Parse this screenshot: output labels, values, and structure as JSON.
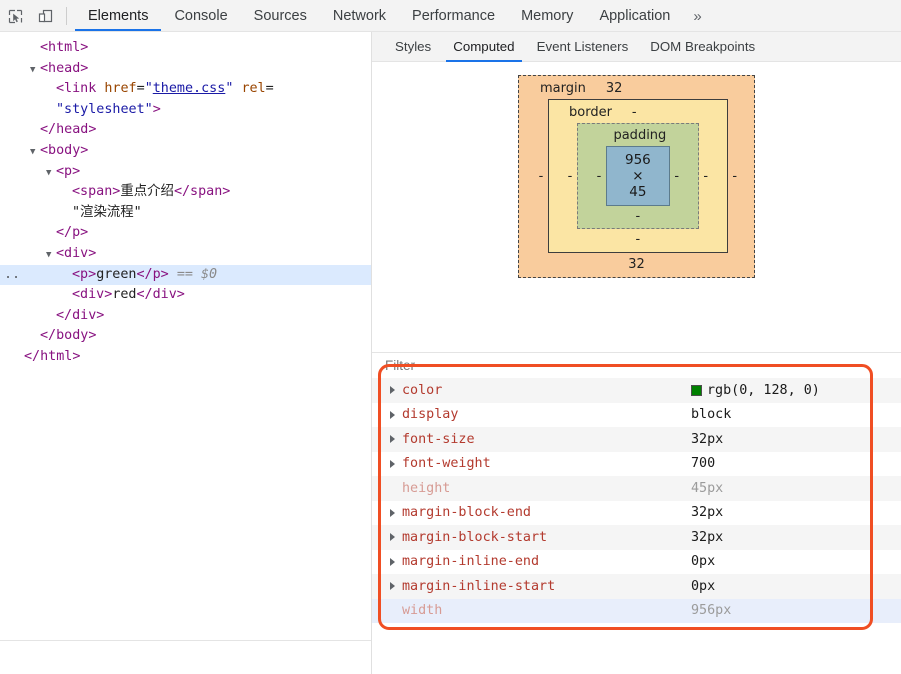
{
  "toolbar": {
    "inspect_icon": "inspect-cursor-icon",
    "device_icon": "device-toolbar-icon",
    "tabs": [
      {
        "label": "Elements",
        "active": true
      },
      {
        "label": "Console",
        "active": false
      },
      {
        "label": "Sources",
        "active": false
      },
      {
        "label": "Network",
        "active": false
      },
      {
        "label": "Performance",
        "active": false
      },
      {
        "label": "Memory",
        "active": false
      },
      {
        "label": "Application",
        "active": false
      }
    ],
    "overflow_label": "»"
  },
  "dom_tree": {
    "lines": [
      {
        "indent": 0,
        "triangle": "",
        "html": "<span class=\"tag\">&lt;html&gt;</span>"
      },
      {
        "indent": 0,
        "triangle": "▼",
        "html": "<span class=\"tag\">&lt;head&gt;</span>"
      },
      {
        "indent": 1,
        "triangle": "",
        "html": "<span class=\"tag\">&lt;link</span> <span class=\"attrname\">href</span>=<span class=\"attrval\">\"<u>theme.css</u>\"</span> <span class=\"attrname\">rel</span>="
      },
      {
        "indent": 1,
        "triangle": "",
        "html": "<span class=\"attrval\">\"stylesheet\"</span><span class=\"tag\">&gt;</span>"
      },
      {
        "indent": 0,
        "triangle": "",
        "html": "<span class=\"tag\">&lt;/head&gt;</span>"
      },
      {
        "indent": 0,
        "triangle": "▼",
        "html": "<span class=\"tag\">&lt;body&gt;</span>"
      },
      {
        "indent": 1,
        "triangle": "▼",
        "html": "<span class=\"tag\">&lt;p&gt;</span>"
      },
      {
        "indent": 2,
        "triangle": "",
        "html": "<span class=\"tag\">&lt;span&gt;</span><span class=\"txt\">重点介绍</span><span class=\"tag\">&lt;/span&gt;</span>"
      },
      {
        "indent": 2,
        "triangle": "",
        "html": "<span class=\"txt\">\"渲染流程\"</span>"
      },
      {
        "indent": 1,
        "triangle": "",
        "html": "<span class=\"tag\">&lt;/p&gt;</span>"
      },
      {
        "indent": 1,
        "triangle": "▼",
        "html": "<span class=\"tag\">&lt;div&gt;</span>"
      },
      {
        "indent": 2,
        "triangle": "",
        "selected": true,
        "dots": "..",
        "html": "<span class=\"tag\">&lt;p&gt;</span><span class=\"txt\">green</span><span class=\"tag\">&lt;/p&gt;</span> <span class=\"eq\">==</span> <span class=\"dollar\">$0</span>"
      },
      {
        "indent": 2,
        "triangle": "",
        "html": "<span class=\"tag\">&lt;div&gt;</span><span class=\"txt\">red</span><span class=\"tag\">&lt;/div&gt;</span>"
      },
      {
        "indent": 1,
        "triangle": "",
        "html": "<span class=\"tag\">&lt;/div&gt;</span>"
      },
      {
        "indent": 0,
        "triangle": "",
        "html": "<span class=\"tag\">&lt;/body&gt;</span>"
      },
      {
        "indent": -1,
        "triangle": "",
        "html": "<span class=\"tag\">&lt;/html&gt;</span>"
      }
    ]
  },
  "sidebar": {
    "tabs": [
      {
        "label": "Styles",
        "active": false
      },
      {
        "label": "Computed",
        "active": true
      },
      {
        "label": "Event Listeners",
        "active": false
      },
      {
        "label": "DOM Breakpoints",
        "active": false
      }
    ]
  },
  "box_model": {
    "margin_label": "margin",
    "margin_top": "32",
    "margin_right": "-",
    "margin_bottom": "32",
    "margin_left": "-",
    "border_label": "border",
    "border_top": "-",
    "border_right": "-",
    "border_bottom": "-",
    "border_left": "-",
    "padding_label": "padding",
    "padding_top": "",
    "padding_right": "-",
    "padding_bottom": "-",
    "padding_left": "-",
    "content_size": "956 × 45",
    "colors": {
      "margin": "#f9cc9d",
      "border": "#fbe5a4",
      "padding": "#c2d39b",
      "content": "#90b6cd"
    }
  },
  "filter": {
    "placeholder": "Filter"
  },
  "computed_properties": [
    {
      "name": "color",
      "value": "rgb(0, 128, 0)",
      "swatch": "#008000",
      "expandable": true,
      "dimmed": false,
      "rowstyle": "odd"
    },
    {
      "name": "display",
      "value": "block",
      "swatch": null,
      "expandable": true,
      "dimmed": false,
      "rowstyle": "plain"
    },
    {
      "name": "font-size",
      "value": "32px",
      "swatch": null,
      "expandable": true,
      "dimmed": false,
      "rowstyle": "odd"
    },
    {
      "name": "font-weight",
      "value": "700",
      "swatch": null,
      "expandable": true,
      "dimmed": false,
      "rowstyle": "plain"
    },
    {
      "name": "height",
      "value": "45px",
      "swatch": null,
      "expandable": false,
      "dimmed": true,
      "rowstyle": "odd"
    },
    {
      "name": "margin-block-end",
      "value": "32px",
      "swatch": null,
      "expandable": true,
      "dimmed": false,
      "rowstyle": "plain"
    },
    {
      "name": "margin-block-start",
      "value": "32px",
      "swatch": null,
      "expandable": true,
      "dimmed": false,
      "rowstyle": "odd"
    },
    {
      "name": "margin-inline-end",
      "value": "0px",
      "swatch": null,
      "expandable": true,
      "dimmed": false,
      "rowstyle": "plain"
    },
    {
      "name": "margin-inline-start",
      "value": "0px",
      "swatch": null,
      "expandable": true,
      "dimmed": false,
      "rowstyle": "odd"
    },
    {
      "name": "width",
      "value": "956px",
      "swatch": null,
      "expandable": false,
      "dimmed": true,
      "rowstyle": "blue"
    }
  ],
  "annotation": {
    "color": "#f04e23"
  }
}
